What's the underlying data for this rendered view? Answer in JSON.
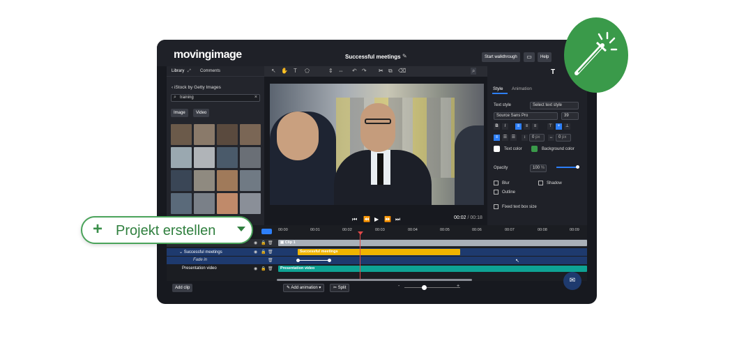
{
  "app": {
    "logo": "movingimage",
    "project_title": "Successful meetings",
    "buttons": {
      "walkthrough": "Start walkthrough",
      "help": "Help"
    }
  },
  "library": {
    "tabs": [
      "Library",
      "Comments"
    ],
    "back_label": "iStock by Getty Images",
    "search_value": "training",
    "filters": [
      "Image",
      "Video"
    ]
  },
  "playback": {
    "current": "00:02",
    "separator": "/",
    "duration": "00:18"
  },
  "properties": {
    "tabs": [
      "Style",
      "Animation"
    ],
    "panel_icon": "T",
    "text_style_label": "Text style",
    "text_style_value": "Select text style",
    "font_value": "Source Sans Pro",
    "font_size": "39",
    "spacing_value_1": "0",
    "spacing_value_2": "0",
    "unit_px": "px",
    "text_color_label": "Text color",
    "bg_color_label": "Background color",
    "opacity_label": "Opacity",
    "opacity_value": "100",
    "opacity_unit": "%",
    "checkbox_blur": "Blur",
    "checkbox_shadow": "Shadow",
    "checkbox_outline": "Outline",
    "checkbox_fixed": "Fixed text box size",
    "colors": {
      "text": "#ffffff",
      "background": "#3a9a4a",
      "accent": "#2d7ff9"
    }
  },
  "timeline": {
    "ticks": [
      "00:00",
      "00:01",
      "00:02",
      "00:03",
      "00:04",
      "00:05",
      "00:06",
      "00:07",
      "00:08",
      "00:09"
    ],
    "tracks": {
      "clip_bar": "Clip 1",
      "successful_label": "Successful meetings",
      "successful_bar": "Successful meetings",
      "fade_label": "Fade in",
      "presentation_label": "Presentation video",
      "presentation_bar": "Presentation video"
    },
    "colors": {
      "clip": "#a9b0b8",
      "title": "#f0b400",
      "video": "#0ea394",
      "playhead": "#e04848"
    }
  },
  "bottom": {
    "add_clip": "Add clip",
    "add_animation": "Add animation",
    "split": "Split",
    "zoom_minus": "-",
    "zoom_plus": "+"
  },
  "cta": {
    "projekt_label": "Projekt erstellen"
  }
}
